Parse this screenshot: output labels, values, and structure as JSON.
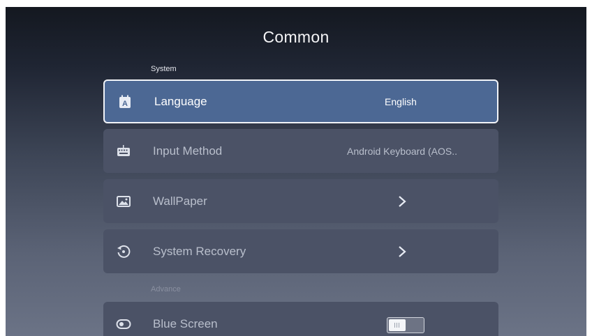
{
  "page": {
    "title": "Common"
  },
  "sections": {
    "system_label": "System",
    "advance_label": "Advance"
  },
  "rows": [
    {
      "label": "Language",
      "value": "English",
      "icon": "language-icon",
      "selected": true
    },
    {
      "label": "Input Method",
      "value": "Android Keyboard (AOS..",
      "icon": "keyboard-icon"
    },
    {
      "label": "WallPaper",
      "icon": "image-icon",
      "trailing": "chevron-right-icon"
    },
    {
      "label": "System Recovery",
      "icon": "recovery-icon",
      "trailing": "chevron-right-icon"
    },
    {
      "label": "Blue Screen",
      "icon": "toggle-icon",
      "trailing": "toggle-switch",
      "toggle_on": false
    }
  ],
  "colors": {
    "selected_row": "#4c6894",
    "row": "#4b5266",
    "background_top": "#141820",
    "background_bottom": "#6b7386"
  }
}
